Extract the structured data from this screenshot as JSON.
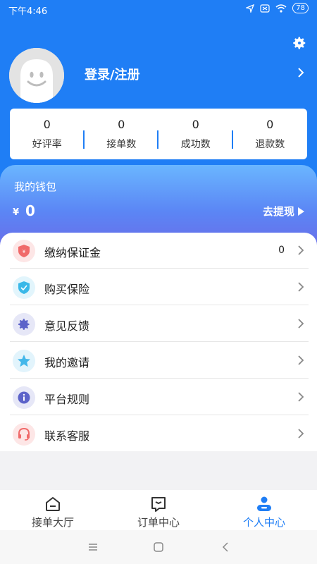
{
  "status_bar": {
    "time": "下午4:46",
    "battery": "78"
  },
  "profile": {
    "login_label": "登录/注册"
  },
  "stats": [
    {
      "value": "0",
      "label": "好评率"
    },
    {
      "value": "0",
      "label": "接单数"
    },
    {
      "value": "0",
      "label": "成功数"
    },
    {
      "value": "0",
      "label": "退款数"
    }
  ],
  "wallet": {
    "title": "我的钱包",
    "currency": "¥",
    "amount": "0",
    "withdraw_label": "去提现"
  },
  "menu": [
    {
      "label": "缴纳保证金",
      "value": "0",
      "icon": "shield-icon",
      "color": "#f06a6a",
      "bg": "#fde6e6"
    },
    {
      "label": "购买保险",
      "value": "",
      "icon": "insurance-icon",
      "color": "#39b8e8",
      "bg": "#e2f5fc"
    },
    {
      "label": "意见反馈",
      "value": "",
      "icon": "gear-icon",
      "color": "#5c63c9",
      "bg": "#e6e7f7"
    },
    {
      "label": "我的邀请",
      "value": "",
      "icon": "star-icon",
      "color": "#43b7ea",
      "bg": "#e2f4fc"
    },
    {
      "label": "平台规则",
      "value": "",
      "icon": "info-icon",
      "color": "#5c63c9",
      "bg": "#e6e7f7"
    },
    {
      "label": "联系客服",
      "value": "",
      "icon": "headset-icon",
      "color": "#f06a6a",
      "bg": "#fde6e6"
    }
  ],
  "tabs": [
    {
      "label": "接单大厅",
      "icon": "home-icon",
      "active": false
    },
    {
      "label": "订单中心",
      "icon": "order-icon",
      "active": false
    },
    {
      "label": "个人中心",
      "icon": "person-icon",
      "active": true
    }
  ],
  "colors": {
    "primary": "#1f7ef5",
    "background": "#f2f2f4"
  }
}
